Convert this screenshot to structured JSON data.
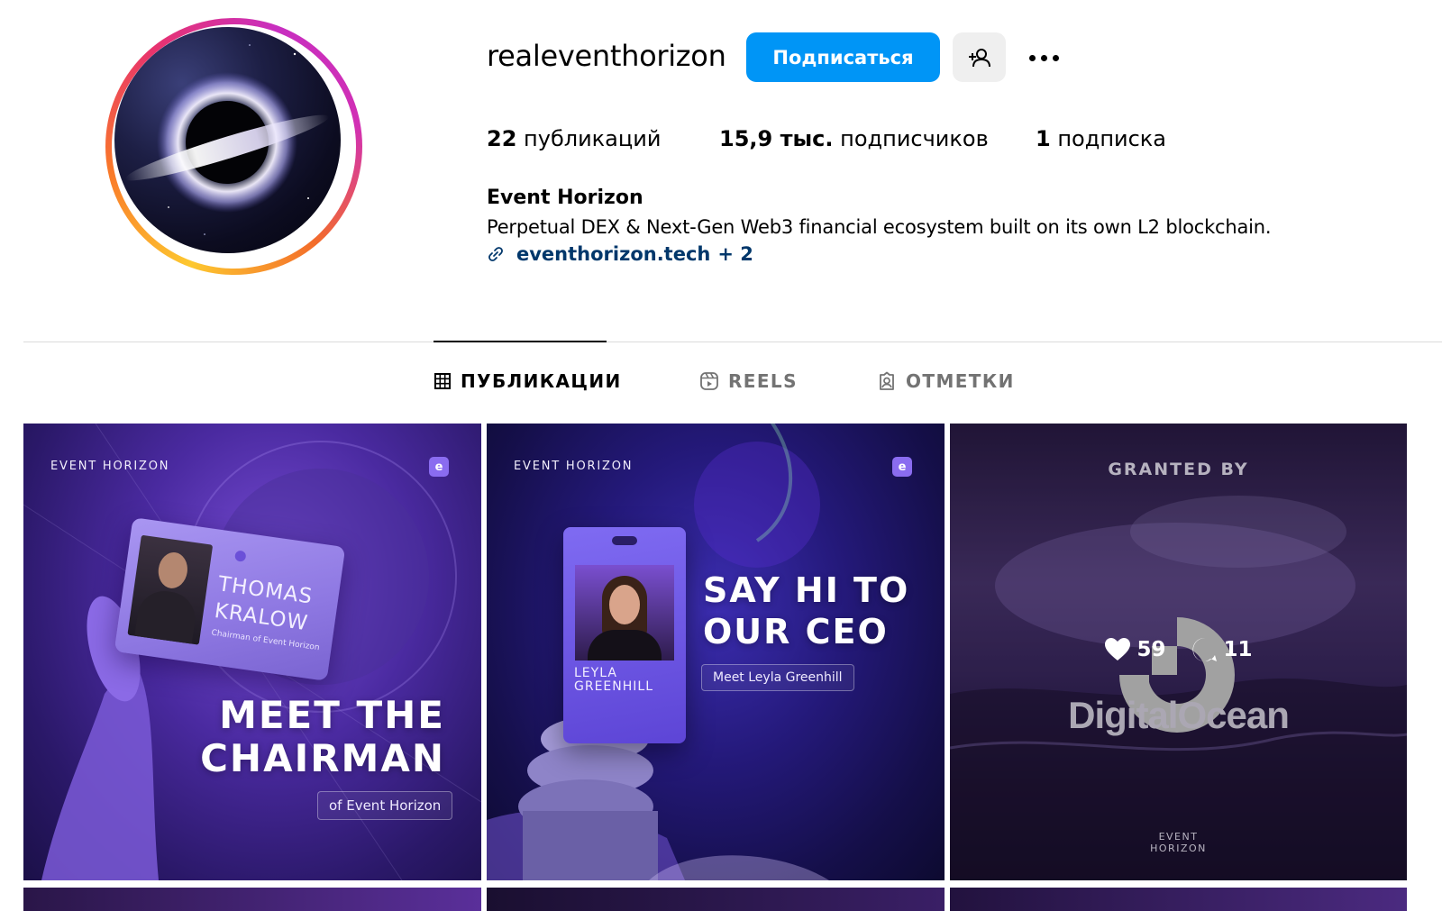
{
  "profile": {
    "username": "realeventhorizon",
    "follow_label": "Подписаться",
    "suggest_icon": "person-plus-icon",
    "more_icon": "more-dots-icon",
    "stats": {
      "posts_count": "22",
      "posts_label": "публикаций",
      "followers_count": "15,9 тыс.",
      "followers_label": "подписчиков",
      "following_count": "1",
      "following_label": "подписка"
    },
    "full_name": "Event Horizon",
    "bio": "Perpetual DEX & Next-Gen Web3 financial ecosystem built on its own L2 blockchain.",
    "link": "eventhorizon.tech",
    "link_extra": "+ 2"
  },
  "tabs": [
    {
      "label": "ПУБЛИКАЦИИ",
      "icon": "grid-icon",
      "active": true
    },
    {
      "label": "REELS",
      "icon": "reels-icon",
      "active": false
    },
    {
      "label": "ОТМЕТКИ",
      "icon": "tagged-icon",
      "active": false
    }
  ],
  "posts": [
    {
      "brand": "EVENT HORIZON",
      "card_name_line1": "THOMAS",
      "card_name_line2": "KRALOW",
      "card_role": "Chairman of Event Horizon",
      "title_line1": "MEET THE",
      "title_line2": "CHAIRMAN",
      "subtitle": "of Event Horizon"
    },
    {
      "brand": "EVENT HORIZON",
      "badge_name_line1": "LEYLA",
      "badge_name_line2": "GREENHILL",
      "title_line1": "SAY HI TO",
      "title_line2": "OUR CEO",
      "subtitle": "Meet Leyla Greenhill"
    },
    {
      "title": "GRANTED BY",
      "sponsor": "DigitalOcean",
      "footer_line1": "EVENT",
      "footer_line2": "HORIZON",
      "likes": "59",
      "comments": "11"
    }
  ],
  "colors": {
    "primary_button": "#0095f6",
    "link": "#00376b",
    "muted": "#737373",
    "divider": "#dbdbdb"
  }
}
